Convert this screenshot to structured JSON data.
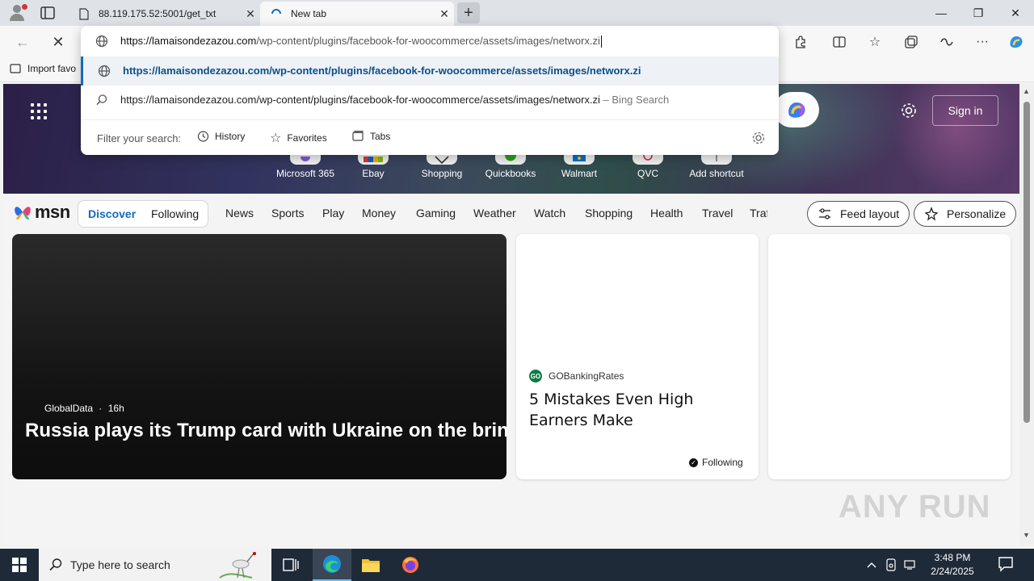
{
  "tabs": [
    {
      "title": "88.119.175.52:5001/get_txt",
      "close": "✕"
    },
    {
      "title": "New tab",
      "close": "✕"
    }
  ],
  "newtab_symbol": "+",
  "window_controls": {
    "minimize": "—",
    "maximize": "❐",
    "close": "✕"
  },
  "omnibox": {
    "domain": "https://lamaisondezazou.com",
    "path": "/wp-content/plugins/facebook-for-woocommerce/assets/images/networx.zi",
    "suggestions": [
      {
        "text": "https://lamaisondezazou.com/wp-content/plugins/facebook-for-woocommerce/assets/images/networx.zi",
        "suffix": "",
        "icon": "globe-icon"
      },
      {
        "text": "https://lamaisondezazou.com/wp-content/plugins/facebook-for-woocommerce/assets/images/networx.zi",
        "suffix": " – Bing Search",
        "icon": "search-icon"
      }
    ],
    "filter_label": "Filter your search:",
    "filters": [
      "History",
      "Favorites",
      "Tabs"
    ]
  },
  "favorites_bar": {
    "import_label": "Import favo"
  },
  "hero": {
    "sign_in": "Sign in",
    "shortcuts": [
      "Microsoft 365",
      "Ebay",
      "Shopping",
      "Quickbooks",
      "Walmart",
      "QVC",
      "Add shortcut"
    ]
  },
  "msn": {
    "logo": "msn",
    "pill_tabs": [
      "Discover",
      "Following"
    ],
    "nav": [
      "News",
      "Sports",
      "Play",
      "Money",
      "Gaming",
      "Weather",
      "Watch",
      "Shopping",
      "Health",
      "Travel"
    ],
    "nav_clipped": "Traffic",
    "feed_layout": "Feed layout",
    "personalize": "Personalize"
  },
  "cards": {
    "big": {
      "source": "GlobalData",
      "age": "16h",
      "title": "Russia plays its Trump card with Ukraine on the brink"
    },
    "mid": {
      "source": "GOBankingRates",
      "logo_text": "GO",
      "title": "5 Mistakes Even High Earners Make",
      "following": "Following"
    }
  },
  "watermark": "ANY RUN",
  "taskbar": {
    "search_placeholder": "Type here to search",
    "time": "3:48 PM",
    "date": "2/24/2025"
  },
  "colors": {
    "accent": "#0f6cbd",
    "taskbar": "#1f2a38"
  }
}
